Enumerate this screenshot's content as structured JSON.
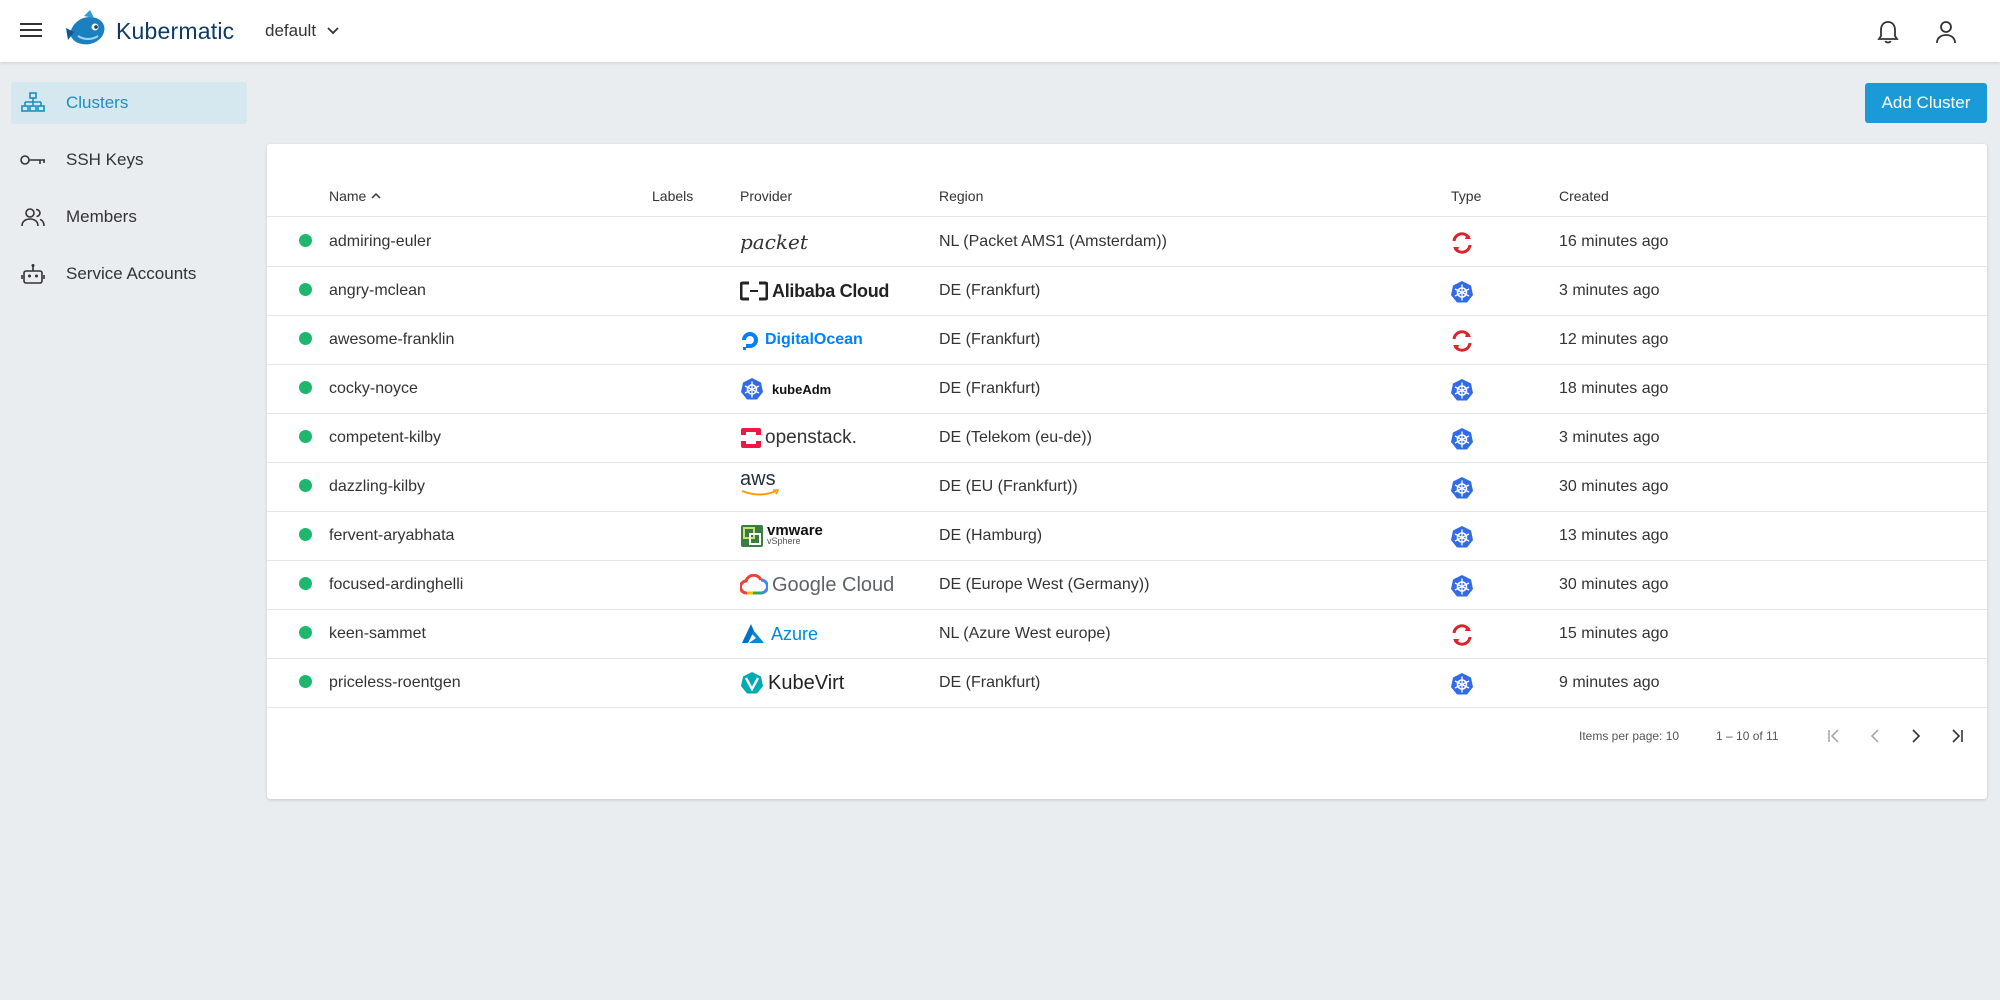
{
  "app": {
    "brand": "Kubermatic",
    "project": "default"
  },
  "sidebar": {
    "items": [
      {
        "label": "Clusters",
        "icon": "clusters-icon",
        "active": true
      },
      {
        "label": "SSH Keys",
        "icon": "key-icon",
        "active": false
      },
      {
        "label": "Members",
        "icon": "members-icon",
        "active": false
      },
      {
        "label": "Service Accounts",
        "icon": "robot-icon",
        "active": false
      }
    ]
  },
  "actions": {
    "add_cluster": "Add Cluster"
  },
  "table": {
    "columns": {
      "name": "Name",
      "labels": "Labels",
      "provider": "Provider",
      "region": "Region",
      "type": "Type",
      "created": "Created"
    },
    "rows": [
      {
        "name": "admiring-euler",
        "provider": "packet",
        "region": "NL (Packet AMS1 (Amsterdam))",
        "type": "openshift",
        "created": "16 minutes ago"
      },
      {
        "name": "angry-mclean",
        "provider": "Alibaba Cloud",
        "region": "DE (Frankfurt)",
        "type": "kubernetes",
        "created": "3 minutes ago"
      },
      {
        "name": "awesome-franklin",
        "provider": "DigitalOcean",
        "region": "DE (Frankfurt)",
        "type": "openshift",
        "created": "12 minutes ago"
      },
      {
        "name": "cocky-noyce",
        "provider": "kubeAdm",
        "region": "DE (Frankfurt)",
        "type": "kubernetes",
        "created": "18 minutes ago"
      },
      {
        "name": "competent-kilby",
        "provider": "openstack.",
        "region": "DE (Telekom (eu-de))",
        "type": "kubernetes",
        "created": "3 minutes ago"
      },
      {
        "name": "dazzling-kilby",
        "provider": "aws",
        "region": "DE (EU (Frankfurt))",
        "type": "kubernetes",
        "created": "30 minutes ago"
      },
      {
        "name": "fervent-aryabhata",
        "provider": "vmware",
        "provider_sub": "vSphere",
        "region": "DE (Hamburg)",
        "type": "kubernetes",
        "created": "13 minutes ago"
      },
      {
        "name": "focused-ardinghelli",
        "provider": "Google Cloud",
        "region": "DE (Europe West (Germany))",
        "type": "kubernetes",
        "created": "30 minutes ago"
      },
      {
        "name": "keen-sammet",
        "provider": "Azure",
        "region": "NL (Azure West europe)",
        "type": "openshift",
        "created": "15 minutes ago"
      },
      {
        "name": "priceless-roentgen",
        "provider": "KubeVirt",
        "region": "DE (Frankfurt)",
        "type": "kubernetes",
        "created": "9 minutes ago"
      }
    ]
  },
  "paginator": {
    "items_per_page_label": "Items per page: 10",
    "range_label": "1 – 10 of 11"
  },
  "colors": {
    "accent": "#1a9bd7",
    "status_ok": "#1db76e",
    "kubernetes": "#326ce5",
    "openshift": "#d8262c"
  }
}
